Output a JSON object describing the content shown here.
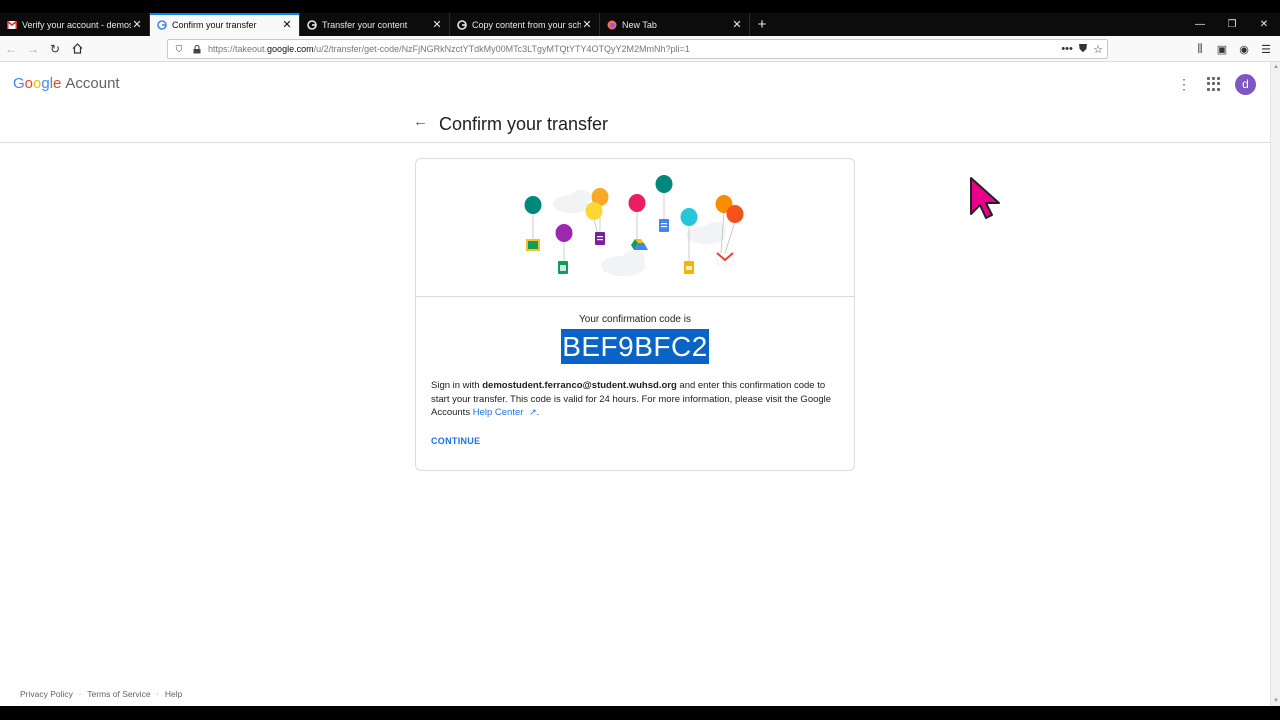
{
  "browser": {
    "tabs": [
      {
        "title": "Verify your account - demostu",
        "icon": "gmail-icon",
        "active": false
      },
      {
        "title": "Confirm your transfer",
        "icon": "google-icon",
        "active": true
      },
      {
        "title": "Transfer your content",
        "icon": "google-icon",
        "active": false
      },
      {
        "title": "Copy content from your schoo",
        "icon": "google-icon",
        "active": false
      },
      {
        "title": "New Tab",
        "icon": "firefox-icon",
        "active": false
      }
    ],
    "new_tab_symbol": "+",
    "url_prefix": "https://takeout.",
    "url_domain": "google.com",
    "url_path": "/u/2/transfer/get-code/NzFjNGRkNzctYTdkMy00MTc3LTgyMTQtYTY4OTQyY2M2MmNh?pli=1"
  },
  "header": {
    "logo_letters": [
      "G",
      "o",
      "o",
      "g",
      "l",
      "e"
    ],
    "logo_suffix": "Account",
    "avatar_letter": "d"
  },
  "page": {
    "title": "Confirm your transfer",
    "code_label": "Your confirmation code is",
    "code": "BEF9BFC2",
    "body_prefix": "Sign in with ",
    "body_email": "demostudent.ferranco@student.wuhsd.org",
    "body_middle": " and enter this confirmation code to start your transfer. This code is valid for 24 hours. For more information, please visit the Google Accounts ",
    "help_link": "Help Center",
    "body_end": ".",
    "continue_label": "CONTINUE"
  },
  "footer": {
    "links": [
      "Privacy Policy",
      "Terms of Service",
      "Help"
    ]
  },
  "colors": {
    "accent": "#1a73e8",
    "highlight": "#0a64c8",
    "avatar": "#7e57c2",
    "cursor": "#e8008a"
  }
}
